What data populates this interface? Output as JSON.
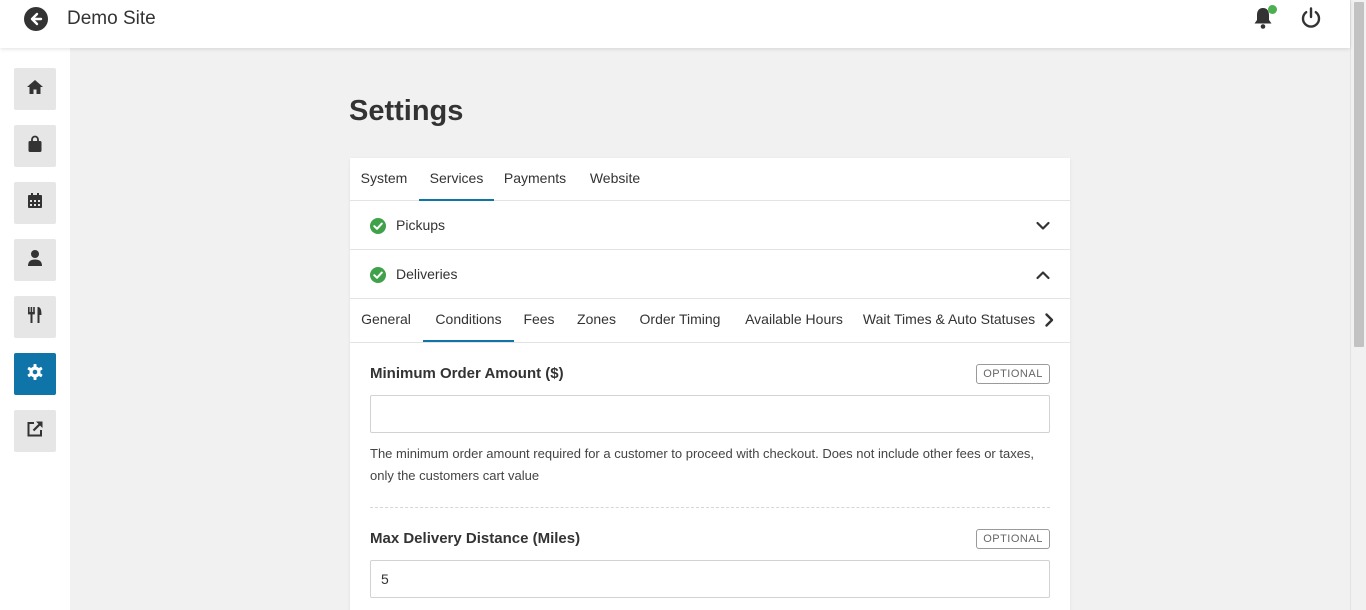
{
  "header": {
    "site_title": "Demo Site",
    "notification_dot_color": "#4caf50"
  },
  "sidebar": {
    "items": [
      {
        "name": "home",
        "icon": "home-icon"
      },
      {
        "name": "orders",
        "icon": "shopping-bag-icon"
      },
      {
        "name": "bookings",
        "icon": "calendar-icon"
      },
      {
        "name": "customers",
        "icon": "user-icon"
      },
      {
        "name": "menus",
        "icon": "utensils-icon"
      },
      {
        "name": "settings",
        "icon": "gear-icon",
        "active": true
      },
      {
        "name": "view-site",
        "icon": "external-link-icon"
      }
    ],
    "active_color": "#0f75a8"
  },
  "page": {
    "title": "Settings"
  },
  "tabs": {
    "items": [
      "System",
      "Services",
      "Payments",
      "Website"
    ],
    "active": "Services"
  },
  "accordion": {
    "pickups_label": "Pickups",
    "deliveries_label": "Deliveries"
  },
  "subtabs": {
    "items": [
      "General",
      "Conditions",
      "Fees",
      "Zones",
      "Order Timing",
      "Available Hours",
      "Wait Times & Auto Statuses"
    ],
    "active": "Conditions"
  },
  "fields": {
    "min_order": {
      "label": "Minimum Order Amount ($)",
      "badge": "OPTIONAL",
      "value": "",
      "help": "The minimum order amount required for a customer to proceed with checkout. Does not include other fees or taxes, only the customers cart value"
    },
    "max_distance": {
      "label": "Max Delivery Distance (Miles)",
      "badge": "OPTIONAL",
      "value": "5"
    }
  }
}
